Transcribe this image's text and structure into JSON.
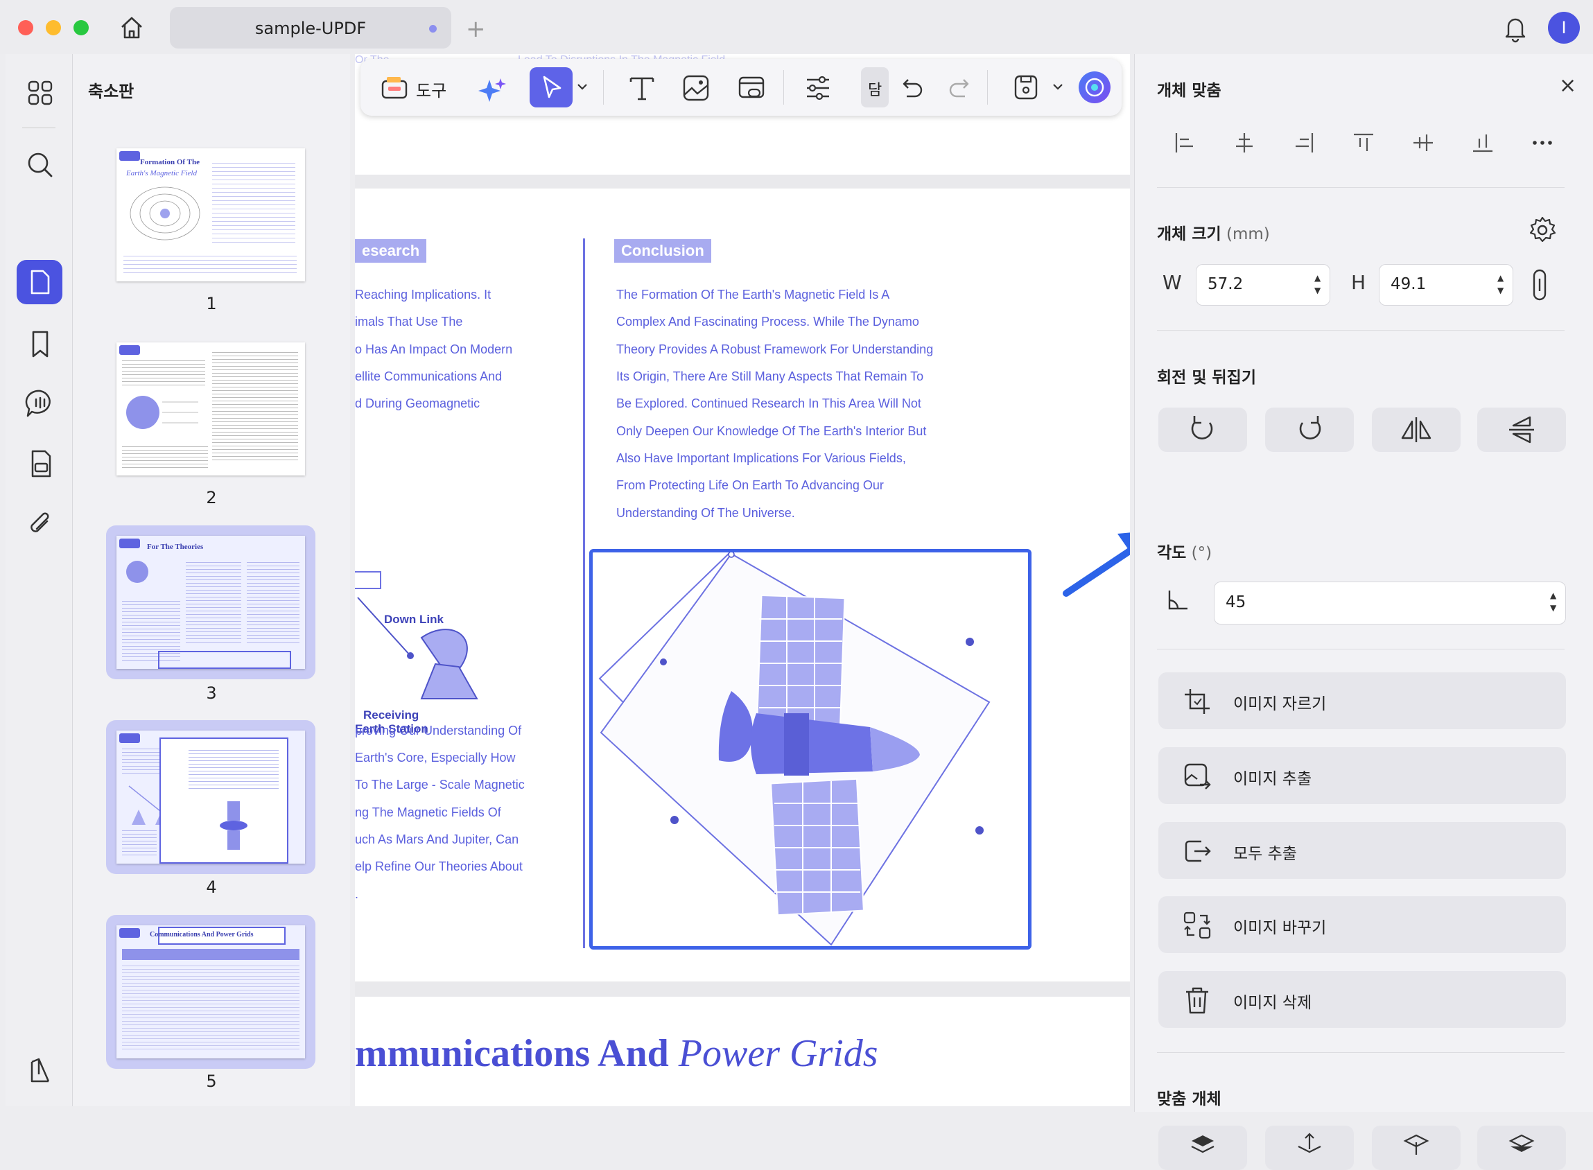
{
  "window": {
    "tab_title": "sample-UPDF",
    "avatar_initial": "I",
    "colors": {
      "accent": "#4b53e0",
      "doc_text": "#5b60de",
      "tag": "#a8abf0"
    }
  },
  "rail": {
    "icons": [
      "grid-icon",
      "search-icon",
      "page-edit-icon",
      "bookmark-icon",
      "comment-icon",
      "page-organize-icon",
      "attachment-icon",
      "layers-icon"
    ]
  },
  "thumbnails": {
    "title": "축소판",
    "pages": [
      {
        "num": "1",
        "heading": "Formation Of The",
        "subheading": "Earth's Magnetic Field"
      },
      {
        "num": "2",
        "heading": "",
        "subheading": ""
      },
      {
        "num": "3",
        "heading": "For The Theories",
        "subheading": ""
      },
      {
        "num": "4",
        "heading": "",
        "subheading": ""
      },
      {
        "num": "5",
        "heading": "Communications And Power Grids",
        "subheading": ""
      }
    ]
  },
  "toolbar": {
    "tools_label": "도구",
    "cut_label": "담"
  },
  "document": {
    "top_fragments": [
      "Or The",
      "Lead To Disruptions In The Magnetic Field"
    ],
    "research_tag": "esearch",
    "left_lines": [
      "Reaching Implications. It",
      "imals That Use The",
      "o Has An Impact On Modern",
      "ellite Communications And",
      "d During Geomagnetic"
    ],
    "conclusion_tag": "Conclusion",
    "conclusion_lines": [
      "The Formation Of The Earth's Magnetic Field Is A",
      "Complex And Fascinating Process. While The Dynamo",
      "Theory Provides A Robust Framework For Understanding",
      "Its Origin, There Are Still Many Aspects That Remain To",
      "Be Explored. Continued Research In This Area Will Not",
      "Only Deepen Our Knowledge Of The Earth's Interior But",
      "Also Have Important Implications For Various Fields,",
      "From Protecting Life On Earth To Advancing Our",
      "Understanding Of The Universe."
    ],
    "diagram": {
      "down_link": "Down Link",
      "receiving": "Receiving",
      "earth_station": "Earth Station"
    },
    "bottom_lines": [
      "proving Our Understanding Of",
      "Earth's Core, Especially How",
      "To The Large - Scale Magnetic",
      "ng The Magnetic Fields Of",
      "uch As Mars And Jupiter, Can",
      "elp Refine Our Theories About",
      "."
    ],
    "heading_part1": "mmunications And ",
    "heading_part2": "Power Grids"
  },
  "panel": {
    "align_title": "개체 맞춤",
    "size_title": "개체 크기",
    "size_unit": "(mm)",
    "w_label": "W",
    "w_value": "57.2",
    "h_label": "H",
    "h_value": "49.1",
    "rotate_title": "회전 및 뒤집기",
    "angle_title": "각도",
    "angle_unit": "(°)",
    "angle_value": "45",
    "actions": [
      "이미지 자르기",
      "이미지 추출",
      "모두 추출",
      "이미지 바꾸기",
      "이미지 삭제"
    ],
    "arrange_title": "맞춤 개체"
  }
}
